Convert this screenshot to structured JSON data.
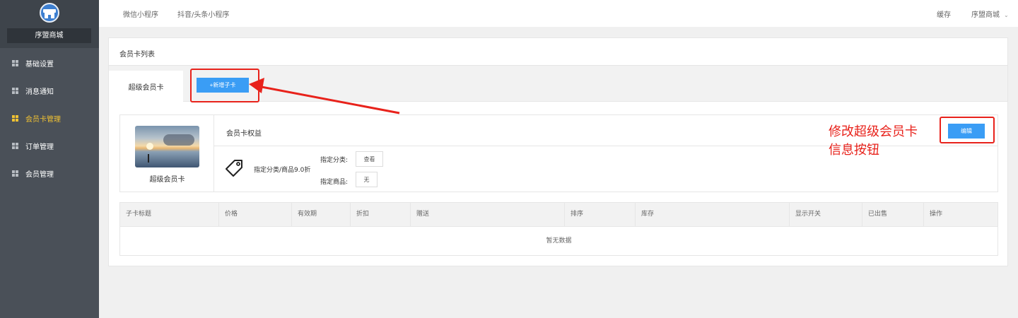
{
  "sidebar": {
    "shop_name": "序盟商城",
    "items": [
      {
        "label": "基础设置",
        "active": false
      },
      {
        "label": "消息通知",
        "active": false
      },
      {
        "label": "会员卡管理",
        "active": true
      },
      {
        "label": "订单管理",
        "active": false
      },
      {
        "label": "会员管理",
        "active": false
      }
    ]
  },
  "topbar": {
    "tabs": [
      "微信小程序",
      "抖音/头条小程序"
    ],
    "cache": "缓存",
    "user": "序盟商城"
  },
  "panel": {
    "title": "会员卡列表",
    "tab_label": "超级会员卡",
    "add_button": "+新增子卡",
    "card": {
      "name": "超级会员卡",
      "benefit_title": "会员卡权益",
      "edit_button": "编辑",
      "discount": "指定分类/商品9.0折",
      "category_label": "指定分类:",
      "category_button": "查看",
      "goods_label": "指定商品:",
      "goods_button": "无"
    },
    "table": {
      "columns": [
        "子卡标题",
        "价格",
        "有效期",
        "折扣",
        "赠送",
        "排序",
        "库存",
        "显示开关",
        "已出售",
        "操作"
      ],
      "empty_text": "暂无数据"
    }
  },
  "annotation": {
    "line1": "修改超级会员卡",
    "line2": "信息按钮"
  },
  "colors": {
    "sidebar_bg": "#4a5058",
    "active": "#f1c232",
    "primary": "#3a9df5",
    "annotation": "#e8221b"
  }
}
